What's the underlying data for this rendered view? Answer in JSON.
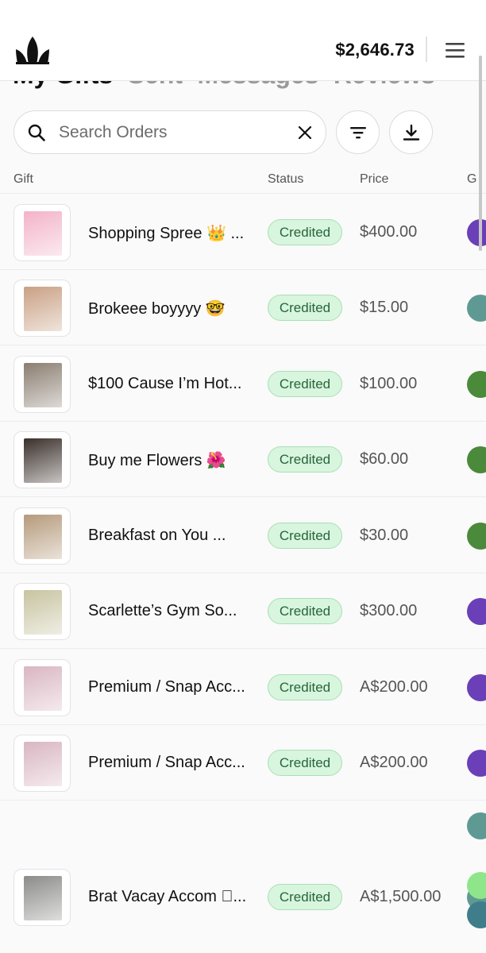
{
  "header": {
    "logo_icon": "crown-flame-logo",
    "balance": "$2,646.73",
    "menu_icon": "hamburger-menu-icon"
  },
  "tabs": [
    {
      "label": "My Gifts",
      "active": true
    },
    {
      "label": "Sent",
      "active": false
    },
    {
      "label": "Messages",
      "active": false
    },
    {
      "label": "Reviews",
      "active": false
    }
  ],
  "search": {
    "placeholder": "Search Orders",
    "value": ""
  },
  "columns": {
    "gift": "Gift",
    "status": "Status",
    "price": "Price",
    "extra": "G"
  },
  "orders": [
    {
      "name": "Shopping Spree 👑 ...",
      "status": "Credited",
      "price": "$400.00",
      "dot_color": "#6b3fb8",
      "thumb_color": "#f3b3c8"
    },
    {
      "name": "Brokeee boyyyy 🤓",
      "status": "Credited",
      "price": "$15.00",
      "dot_color": "#5e9a93",
      "thumb_color": "#c9a084"
    },
    {
      "name": "$100 Cause I’m Hot...",
      "status": "Credited",
      "price": "$100.00",
      "dot_color": "#4a8a3a",
      "thumb_color": "#8a7d70"
    },
    {
      "name": "Buy me Flowers 🌺",
      "status": "Credited",
      "price": "$60.00",
      "dot_color": "#4a8a3a",
      "thumb_color": "#3a2f2a"
    },
    {
      "name": "Breakfast on You ...",
      "status": "Credited",
      "price": "$30.00",
      "dot_color": "#4a8a3a",
      "thumb_color": "#b59a7b"
    },
    {
      "name": "Scarlette’s Gym So...",
      "status": "Credited",
      "price": "$300.00",
      "dot_color": "#6b3fb8",
      "thumb_color": "#c8c3a0"
    },
    {
      "name": "Premium / Snap Acc...",
      "status": "Credited",
      "price": "A$200.00",
      "dot_color": "#6b3fb8",
      "thumb_color": "#d9b6c1"
    },
    {
      "name": "Premium / Snap Acc...",
      "status": "Credited",
      "price": "A$200.00",
      "dot_color": "#6b3fb8",
      "thumb_color": "#d9b6c1"
    },
    {
      "name": "Brat Vacay Accom 🏼...",
      "status": "Credited",
      "price": "A$1,500.00",
      "dot_color": "#5e9a93",
      "thumb_color": "#8b8b88"
    }
  ],
  "extra_dots": [
    "#5e9a93",
    "#8fe58a",
    "#3f7d8a"
  ]
}
